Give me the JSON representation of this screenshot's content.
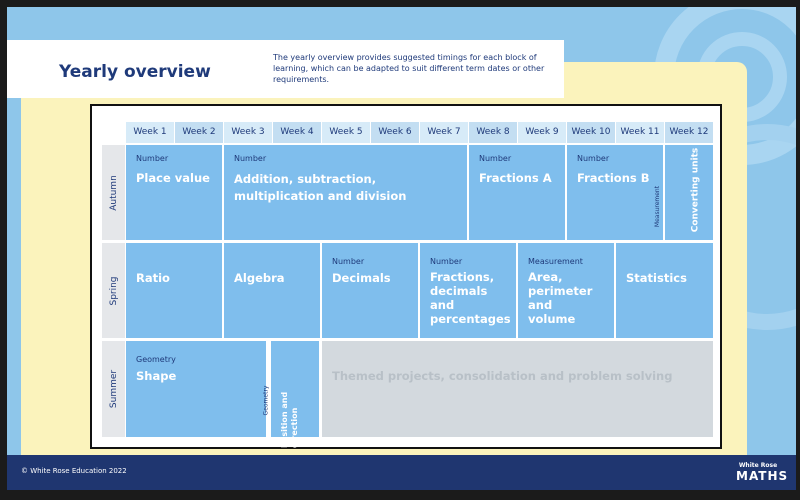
{
  "header": {
    "title": "Yearly overview",
    "intro": "The yearly overview provides suggested timings for each block of learning, which can be adapted to suit different term dates or other requirements."
  },
  "weeks": [
    "Week 1",
    "Week 2",
    "Week 3",
    "Week 4",
    "Week 5",
    "Week 6",
    "Week 7",
    "Week 8",
    "Week 9",
    "Week 10",
    "Week 11",
    "Week 12"
  ],
  "terms": {
    "autumn": "Autumn",
    "spring": "Spring",
    "summer": "Summer"
  },
  "autumn": {
    "place_value": {
      "strand": "Number",
      "name": "Place value"
    },
    "addition": {
      "strand": "Number",
      "name": "Addition, subtraction, multiplication and division"
    },
    "fractions_a": {
      "strand": "Number",
      "name": "Fractions A"
    },
    "fractions_b": {
      "strand": "Number",
      "name": "Fractions B"
    },
    "converting": {
      "strand": "Measurement",
      "name": "Converting units"
    }
  },
  "spring": {
    "ratio": {
      "name": "Ratio"
    },
    "algebra": {
      "name": "Algebra"
    },
    "decimals": {
      "strand": "Number",
      "name": "Decimals"
    },
    "fdp": {
      "strand": "Number",
      "name": "Fractions, decimals and percentages"
    },
    "area": {
      "strand": "Measurement",
      "name": "Area, perimeter and volume"
    },
    "statistics": {
      "name": "Statistics"
    }
  },
  "summer": {
    "shape": {
      "strand": "Geometry",
      "name": "Shape"
    },
    "position": {
      "strand": "Geometry",
      "name": "Position and direction"
    },
    "themed": {
      "name": "Themed projects, consolidation and problem solving"
    }
  },
  "footer": {
    "copyright": "© White Rose Education 2022",
    "brand_top": "White Rose",
    "brand": "MATHS"
  },
  "colors": {
    "background": "#8ec6ea",
    "navy": "#1f3670",
    "block": "#7fbeed",
    "themed": "#d3d9de",
    "yellow_panel": "#fbf3bc"
  }
}
